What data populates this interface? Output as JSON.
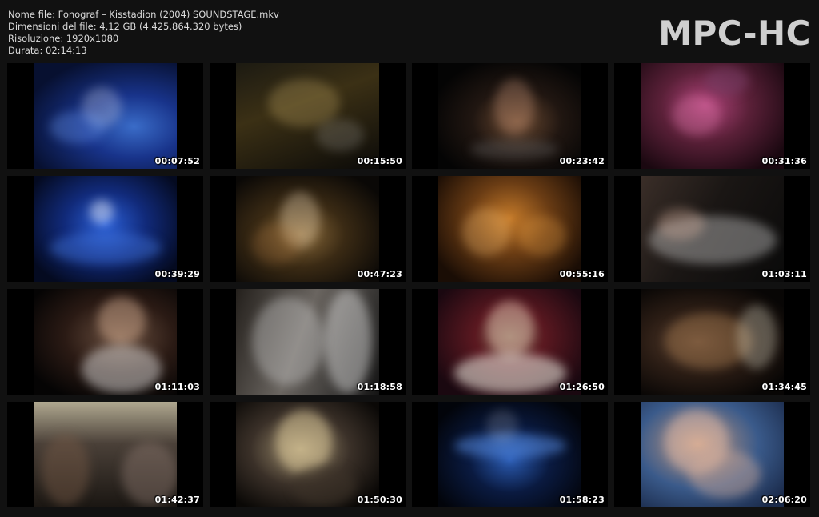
{
  "header": {
    "file_name": "Nome file: Fonograf – Kisstadion (2004) SOUNDSTAGE.mkv",
    "file_size": "Dimensioni del file: 4,12 GB (4.425.864.320 bytes)",
    "resolution": "Risoluzione: 1920x1080",
    "duration": "Durata: 02:14:13"
  },
  "logo": "MPC-HC",
  "thumbnails": [
    {
      "time": "00:07:52",
      "scene": "s1",
      "wide": false
    },
    {
      "time": "00:15:50",
      "scene": "s2",
      "wide": false
    },
    {
      "time": "00:23:42",
      "scene": "s3",
      "wide": false
    },
    {
      "time": "00:31:36",
      "scene": "s4",
      "wide": false
    },
    {
      "time": "00:39:29",
      "scene": "s5",
      "wide": false
    },
    {
      "time": "00:47:23",
      "scene": "s6",
      "wide": false
    },
    {
      "time": "00:55:16",
      "scene": "s7",
      "wide": false
    },
    {
      "time": "01:03:11",
      "scene": "s8",
      "wide": false
    },
    {
      "time": "01:11:03",
      "scene": "s9",
      "wide": false
    },
    {
      "time": "01:18:58",
      "scene": "s10",
      "wide": false
    },
    {
      "time": "01:26:50",
      "scene": "s11",
      "wide": false
    },
    {
      "time": "01:34:45",
      "scene": "s12",
      "wide": false
    },
    {
      "time": "01:42:37",
      "scene": "s13",
      "wide": false
    },
    {
      "time": "01:50:30",
      "scene": "s14",
      "wide": false
    },
    {
      "time": "01:58:23",
      "scene": "s15",
      "wide": false
    },
    {
      "time": "02:06:20",
      "scene": "s16",
      "wide": false
    }
  ]
}
